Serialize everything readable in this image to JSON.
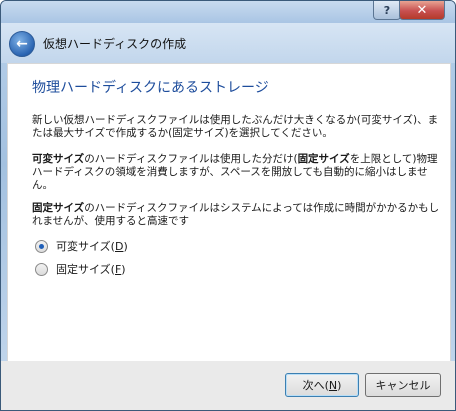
{
  "window": {
    "help_glyph": "?",
    "close_glyph": "✕"
  },
  "nav": {
    "back_glyph": "←",
    "title": "仮想ハードディスクの作成"
  },
  "content": {
    "heading": "物理ハードディスクにあるストレージ",
    "paragraph1": "新しい仮想ハードディスクファイルは使用したぶんだけ大きくなるか(可変サイズ)、または最大サイズで作成するか(固定サイズ)を選択してください。",
    "paragraph2": {
      "bold1": "可変サイズ",
      "text1": "のハードディスクファイルは使用した分だけ(",
      "bold2": "固定サイズ",
      "text2": "を上限として)物理ハードディスクの領域を消費しますが、スペースを開放しても自動的に縮小はしません。"
    },
    "paragraph3": {
      "bold1": "固定サイズ",
      "text1": "のハードディスクファイルはシステムによっては作成に時間がかかるかもしれませんが、使用すると高速です"
    },
    "options": [
      {
        "label_prefix": "可変サイズ(",
        "mnemonic": "D",
        "label_suffix": ")",
        "selected": true
      },
      {
        "label_prefix": "固定サイズ(",
        "mnemonic": "F",
        "label_suffix": ")",
        "selected": false
      }
    ]
  },
  "footer": {
    "next": {
      "label_prefix": "次へ(",
      "mnemonic": "N",
      "label_suffix": ")"
    },
    "cancel": {
      "label": "キャンセル"
    }
  }
}
